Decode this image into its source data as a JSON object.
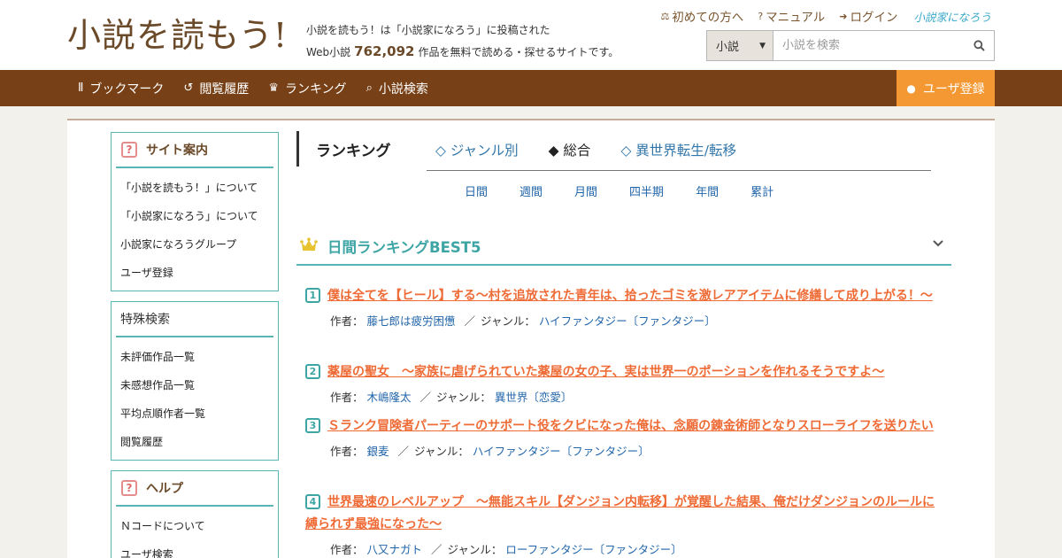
{
  "header": {
    "logo_text": "小説を読もう!",
    "tagline_line1": "小説を読もう！は「小説家になろう」に投稿された",
    "tagline_pre": "Web小説",
    "tagline_count": "762,092",
    "tagline_post": "作品を無料で読める・探せるサイトです。",
    "top_links": [
      "初めての方へ",
      "マニュアル",
      "ログイン"
    ],
    "narou_logo": "小説家になろう",
    "search": {
      "type_label": "小説",
      "placeholder": "小説を検索"
    }
  },
  "nav": {
    "items": [
      "ブックマーク",
      "閲覧履歴",
      "ランキング",
      "小説検索"
    ],
    "register_label": "ユーザ登録"
  },
  "sidebar": {
    "site_info": {
      "title": "サイト案内",
      "items": [
        "「小説を読もう！」について",
        "「小説家になろう」について",
        "小説家になろうグループ",
        "ユーザ登録"
      ]
    },
    "special_search": {
      "title": "特殊検索",
      "items": [
        "未評価作品一覧",
        "未感想作品一覧",
        "平均点順作者一覧",
        "閲覧履歴"
      ]
    },
    "help": {
      "title": "ヘルプ",
      "items": [
        "Ｎコードについて",
        "ユーザ検索"
      ]
    }
  },
  "ranking": {
    "title": "ランキング",
    "tabs": [
      "◇ ジャンル別",
      "◆ 総合",
      "◇ 異世界転生/転移"
    ],
    "periods": [
      "日間",
      "週間",
      "月間",
      "四半期",
      "年間",
      "累計"
    ],
    "section_title": "日間ランキングBEST5",
    "author_label": "作者：",
    "genre_label": "ジャンル：",
    "items": [
      {
        "rank": "1",
        "title": "僕は全てを【ヒール】する～村を追放された青年は、拾ったゴミを激レアアイテムに修繕して成り上がる！～",
        "author": "藤七郎は疲労困憊",
        "genre": "ハイファンタジー〔ファンタジー〕"
      },
      {
        "rank": "2",
        "title": "薬屋の聖女　～家族に虐げられていた薬屋の女の子、実は世界一のポーションを作れるそうですよ～",
        "author": "木嶋隆太",
        "genre": "異世界〔恋愛〕"
      },
      {
        "rank": "3",
        "title": "Ｓランク冒険者パーティーのサポート役をクビになった俺は、念願の錬金術師となりスローライフを送りたい",
        "author": "銀麦",
        "genre": "ハイファンタジー〔ファンタジー〕"
      },
      {
        "rank": "4",
        "title": "世界最速のレベルアップ　～無能スキル【ダンジョン内転移】が覚醒した結果、俺だけダンジョンのルールに縛られず最強になった～",
        "author": "八又ナガト",
        "genre": "ローファンタジー〔ファンタジー〕"
      }
    ]
  },
  "colors": {
    "nav_bg": "#774016",
    "register_bg": "#f39833",
    "teal": "#58b6b4",
    "title_orange": "#ef6b36",
    "link_blue": "#2266aa"
  }
}
